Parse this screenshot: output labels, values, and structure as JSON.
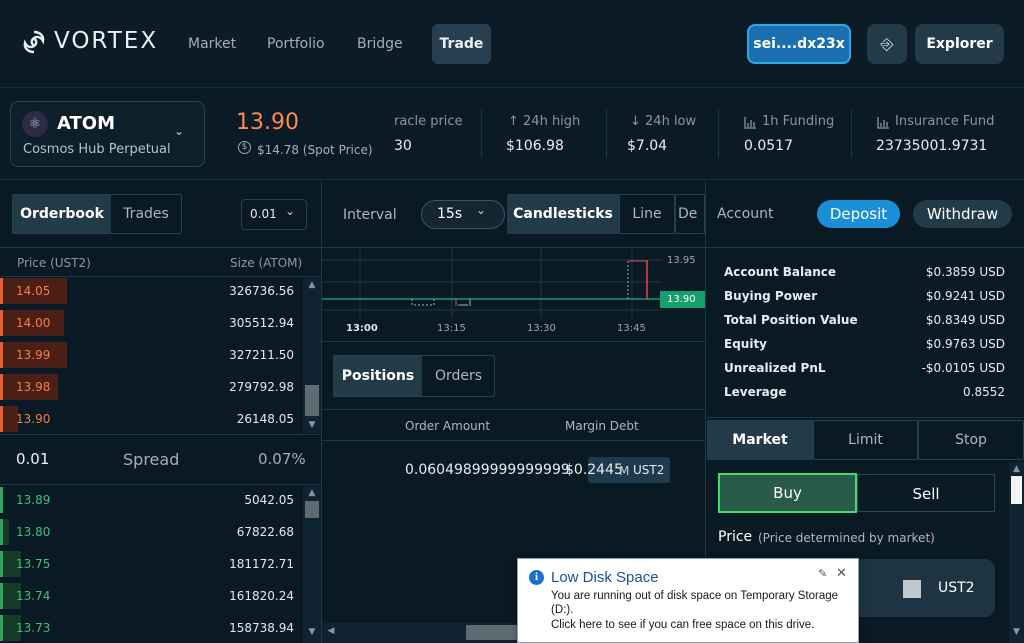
{
  "header": {
    "logo_text": "VORTEX",
    "nav": [
      "Market",
      "Portfolio",
      "Bridge",
      "Trade"
    ],
    "wallet": "sei....dx23x",
    "explorer": "Explorer"
  },
  "market": {
    "symbol": "ATOM",
    "name": "Cosmos Hub Perpetual",
    "last_price": "13.90",
    "spot_price": "$14.78 (Spot Price)",
    "stats": [
      {
        "label": "racle price",
        "value": "30"
      },
      {
        "label": "↑ 24h high",
        "value": "$106.98"
      },
      {
        "label": "↓ 24h low",
        "value": "$7.04"
      },
      {
        "label": "1h Funding",
        "value": "0.0517"
      },
      {
        "label": "Insurance Fund",
        "value": "23735001.9731"
      }
    ]
  },
  "orderbook": {
    "tabs": [
      "Orderbook",
      "Trades"
    ],
    "tick": "0.01",
    "col_price": "Price (UST2)",
    "col_size": "Size (ATOM)",
    "asks": [
      {
        "price": "14.05",
        "size": "326736.56",
        "depth": 0.22
      },
      {
        "price": "14.00",
        "size": "305512.94",
        "depth": 0.21
      },
      {
        "price": "13.99",
        "size": "327211.50",
        "depth": 0.22
      },
      {
        "price": "13.98",
        "size": "279792.98",
        "depth": 0.19
      },
      {
        "price": "13.90",
        "size": "26148.05",
        "depth": 0.06
      }
    ],
    "spread_value": "0.01",
    "spread_label": "Spread",
    "spread_pct": "0.07%",
    "bids": [
      {
        "price": "13.89",
        "size": "5042.05",
        "depth": 0.01
      },
      {
        "price": "13.80",
        "size": "67822.68",
        "depth": 0.03
      },
      {
        "price": "13.75",
        "size": "181172.71",
        "depth": 0.07
      },
      {
        "price": "13.74",
        "size": "161820.24",
        "depth": 0.07
      },
      {
        "price": "13.73",
        "size": "158738.94",
        "depth": 0.07
      }
    ]
  },
  "chart": {
    "interval_label": "Interval",
    "interval": "15s",
    "types": [
      "Candlesticks",
      "Line",
      "De"
    ],
    "y_ticks": [
      "13.95",
      "13.90"
    ],
    "current_price": "13.90",
    "x_ticks": [
      "13:00",
      "13:15",
      "13:30",
      "13:45"
    ]
  },
  "positions": {
    "tabs": [
      "Positions",
      "Orders"
    ],
    "columns": [
      "Order Amount",
      "Margin Debt"
    ],
    "row_amount": "0.06049899999999999",
    "row_debt": "$0.2445",
    "row_unit": "UST2",
    "row_overlay": "M"
  },
  "account": {
    "title": "Account",
    "deposit": "Deposit",
    "withdraw": "Withdraw",
    "rows": [
      {
        "label": "Account Balance",
        "value": "$0.3859 USD"
      },
      {
        "label": "Buying Power",
        "value": "$0.9241 USD"
      },
      {
        "label": "Total Position Value",
        "value": "$0.8349 USD"
      },
      {
        "label": "Equity",
        "value": "$0.9763 USD"
      },
      {
        "label": "Unrealized PnL",
        "value": "-$0.0105 USD"
      },
      {
        "label": "Leverage",
        "value": "0.8552"
      }
    ]
  },
  "order_form": {
    "types": [
      "Market",
      "Limit",
      "Stop"
    ],
    "buy": "Buy",
    "sell": "Sell",
    "price_label": "Price",
    "price_note": "(Price determined by market)",
    "unit": "UST2"
  },
  "notification": {
    "title": "Low Disk Space",
    "line1": "You are running out of disk space on Temporary Storage",
    "line2": "(D:).",
    "line3": "Click here to see if you can free space on this drive."
  },
  "colors": {
    "ask": "#ff7a3e",
    "bid": "#3fc277",
    "accent": "#1a8fd8",
    "price_tag": "#14a06e"
  }
}
